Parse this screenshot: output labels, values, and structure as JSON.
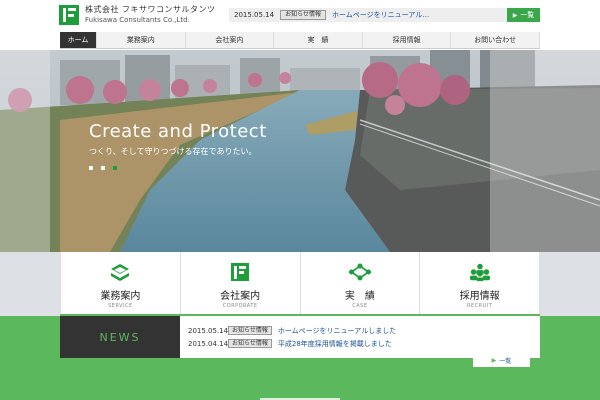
{
  "header": {
    "logo_jp": "株式会社 フキサワコンサルタンツ",
    "logo_en": "Fukisawa Consultants Co.,Ltd.",
    "ticker": {
      "date": "2015.05.14",
      "category": "お知らせ情報",
      "text": "ホームページをリニューアル…",
      "button": "一覧"
    }
  },
  "nav": {
    "items": [
      "ホーム",
      "業務案内",
      "会社案内",
      "実　績",
      "採用情報",
      "お問い合わせ"
    ]
  },
  "hero": {
    "title": "Create and Protect",
    "subtitle": "つくり、そして守りつづける存在でありたい。",
    "slide_count": 3,
    "active_slide": 3
  },
  "services": [
    {
      "label": "業務案内",
      "en": "SERVICE",
      "icon": "stack-icon"
    },
    {
      "label": "会社案内",
      "en": "CORPORATE",
      "icon": "company-logo-icon"
    },
    {
      "label": "実　績",
      "en": "CASE",
      "icon": "network-icon"
    },
    {
      "label": "採用情報",
      "en": "RECRUIT",
      "icon": "people-icon"
    }
  ],
  "news": {
    "heading": "NEWS",
    "items": [
      {
        "date": "2015.05.14",
        "category": "お知らせ情報",
        "text": "ホームページをリニューアルしました"
      },
      {
        "date": "2015.04.14",
        "category": "お知らせ情報",
        "text": "平成28年度採用情報を掲載しました"
      }
    ],
    "more": "一覧"
  },
  "colors": {
    "brand_green": "#1e9e3a",
    "accent_green": "#5cb85c",
    "nav_active": "#333333"
  }
}
